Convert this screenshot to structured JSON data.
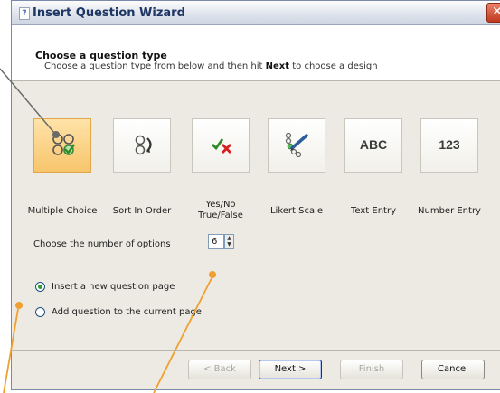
{
  "window": {
    "title": "Insert Question Wizard",
    "icon_glyph": "?",
    "close_glyph": "✕"
  },
  "header": {
    "title": "Choose a question type",
    "desc_prefix": "Choose a question type from below and then hit ",
    "desc_bold": "Next",
    "desc_suffix": " to choose a design"
  },
  "question_types": [
    {
      "label": "Multiple Choice",
      "icon": "multiple-choice-icon",
      "selected": true
    },
    {
      "label": "Sort In Order",
      "icon": "sort-order-icon",
      "selected": false
    },
    {
      "label_line1": "Yes/No",
      "label_line2": "True/False",
      "icon": "yes-no-icon",
      "selected": false
    },
    {
      "label": "Likert Scale",
      "icon": "likert-scale-icon",
      "selected": false
    },
    {
      "label": "Text Entry",
      "icon_text": "ABC",
      "selected": false
    },
    {
      "label": "Number Entry",
      "icon_text": "123",
      "selected": false
    }
  ],
  "options": {
    "label": "Choose the number of options",
    "value": "6"
  },
  "placement": {
    "new_page": "Insert a new question page",
    "current_page": "Add question to the current page",
    "selected": "new_page"
  },
  "buttons": {
    "back": "< Back",
    "next": "Next >",
    "finish": "Finish",
    "cancel": "Cancel"
  },
  "colors": {
    "selected_bg": "#f7c56c",
    "callout_line": "#f0a030",
    "title_text": "#1e3663"
  }
}
